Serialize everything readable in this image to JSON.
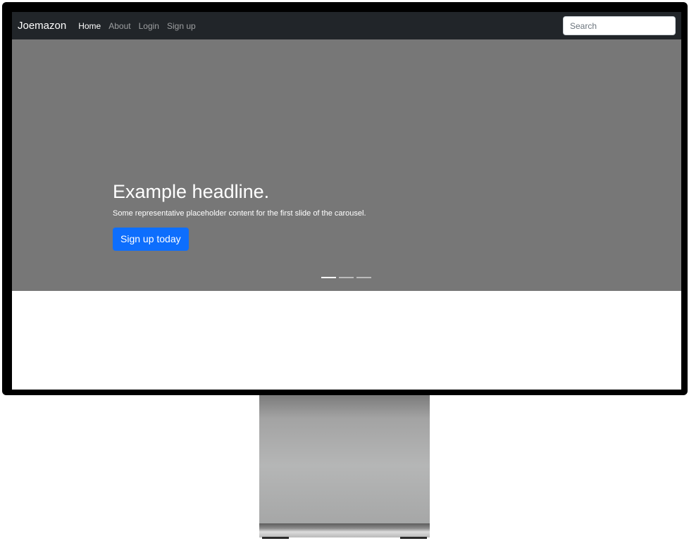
{
  "navbar": {
    "brand": "Joemazon",
    "links": [
      {
        "label": "Home",
        "active": true
      },
      {
        "label": "About",
        "active": false
      },
      {
        "label": "Login",
        "active": false
      },
      {
        "label": "Sign up",
        "active": false
      }
    ],
    "search": {
      "placeholder": "Search",
      "value": ""
    }
  },
  "carousel": {
    "headline": "Example headline.",
    "text": "Some representative placeholder content for the first slide of the carousel.",
    "button_label": "Sign up today",
    "slide_count": 3,
    "active_slide": 1
  },
  "colors": {
    "navbar_bg": "#212529",
    "carousel_bg": "#777777",
    "primary_button": "#0d6efd",
    "monitor_frame": "#000000"
  }
}
